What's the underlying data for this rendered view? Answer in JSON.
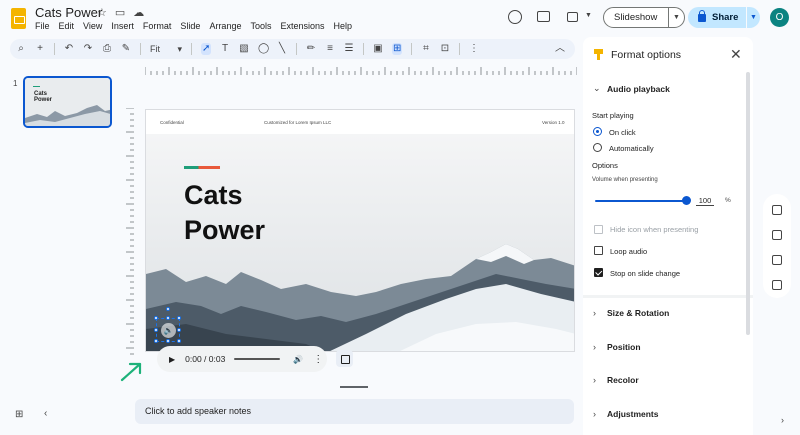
{
  "app": {
    "title": "Cats Power",
    "menu": [
      "File",
      "Edit",
      "View",
      "Insert",
      "Format",
      "Slide",
      "Arrange",
      "Tools",
      "Extensions",
      "Help"
    ],
    "slideshow_label": "Slideshow",
    "share_label": "Share",
    "avatar_initial": "O"
  },
  "toolbar": {
    "zoom_value": "Fit"
  },
  "filmstrip": {
    "slides": [
      {
        "number": "1",
        "title_line1": "Cats",
        "title_line2": "Power"
      }
    ]
  },
  "slide": {
    "header_left": "Confidential",
    "header_mid": "Customized for Lorem Ipsum LLC",
    "header_right": "Version 1.0",
    "title_line1": "Cats",
    "title_line2": "Power",
    "accent_colors": [
      "#1f9e7a",
      "#e8593b"
    ]
  },
  "audio_player": {
    "time": "0:00 / 0:03",
    "progress": 0
  },
  "notes": {
    "placeholder": "Click to add speaker notes"
  },
  "format_panel": {
    "title": "Format options",
    "audio_playback": {
      "heading": "Audio playback",
      "start_playing_label": "Start playing",
      "options": [
        {
          "label": "On click",
          "selected": true
        },
        {
          "label": "Automatically",
          "selected": false
        }
      ],
      "options_label": "Options",
      "volume_label": "Volume when presenting",
      "volume_value": "100",
      "volume_unit": "%",
      "checkboxes": [
        {
          "label": "Hide icon when presenting",
          "checked": false,
          "disabled": true
        },
        {
          "label": "Loop audio",
          "checked": false,
          "disabled": false
        },
        {
          "label": "Stop on slide change",
          "checked": true,
          "disabled": false
        }
      ]
    },
    "sections": [
      "Size & Rotation",
      "Position",
      "Recolor",
      "Adjustments"
    ]
  },
  "colors": {
    "accent": "#0b57d0",
    "share_bg": "#c2e7ff",
    "avatar_bg": "#0b8381",
    "annotation_arrow": "#1db27a"
  }
}
